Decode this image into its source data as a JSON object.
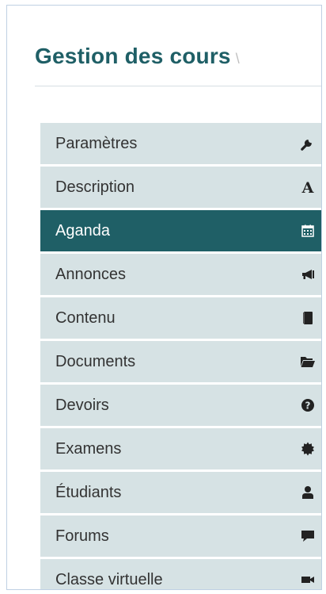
{
  "header": {
    "title": "Gestion des cours",
    "separator": "\\"
  },
  "menu": {
    "active_index": 2,
    "items": [
      {
        "label": "Paramètres",
        "icon": "wrench-icon"
      },
      {
        "label": "Description",
        "icon": "font-icon"
      },
      {
        "label": "Aganda",
        "icon": "calendar-icon"
      },
      {
        "label": "Annonces",
        "icon": "bullhorn-icon"
      },
      {
        "label": "Contenu",
        "icon": "book-icon"
      },
      {
        "label": "Documents",
        "icon": "folder-open-icon"
      },
      {
        "label": "Devoirs",
        "icon": "question-circle-icon"
      },
      {
        "label": "Examens",
        "icon": "certificate-icon"
      },
      {
        "label": "Étudiants",
        "icon": "user-icon"
      },
      {
        "label": "Forums",
        "icon": "comment-icon"
      },
      {
        "label": "Classe virtuelle",
        "icon": "video-camera-icon"
      }
    ]
  },
  "colors": {
    "accent": "#1f5f66",
    "item_bg": "#d6e2e4",
    "item_text": "#333333",
    "active_text": "#ffffff",
    "border": "#bfd0e3"
  }
}
